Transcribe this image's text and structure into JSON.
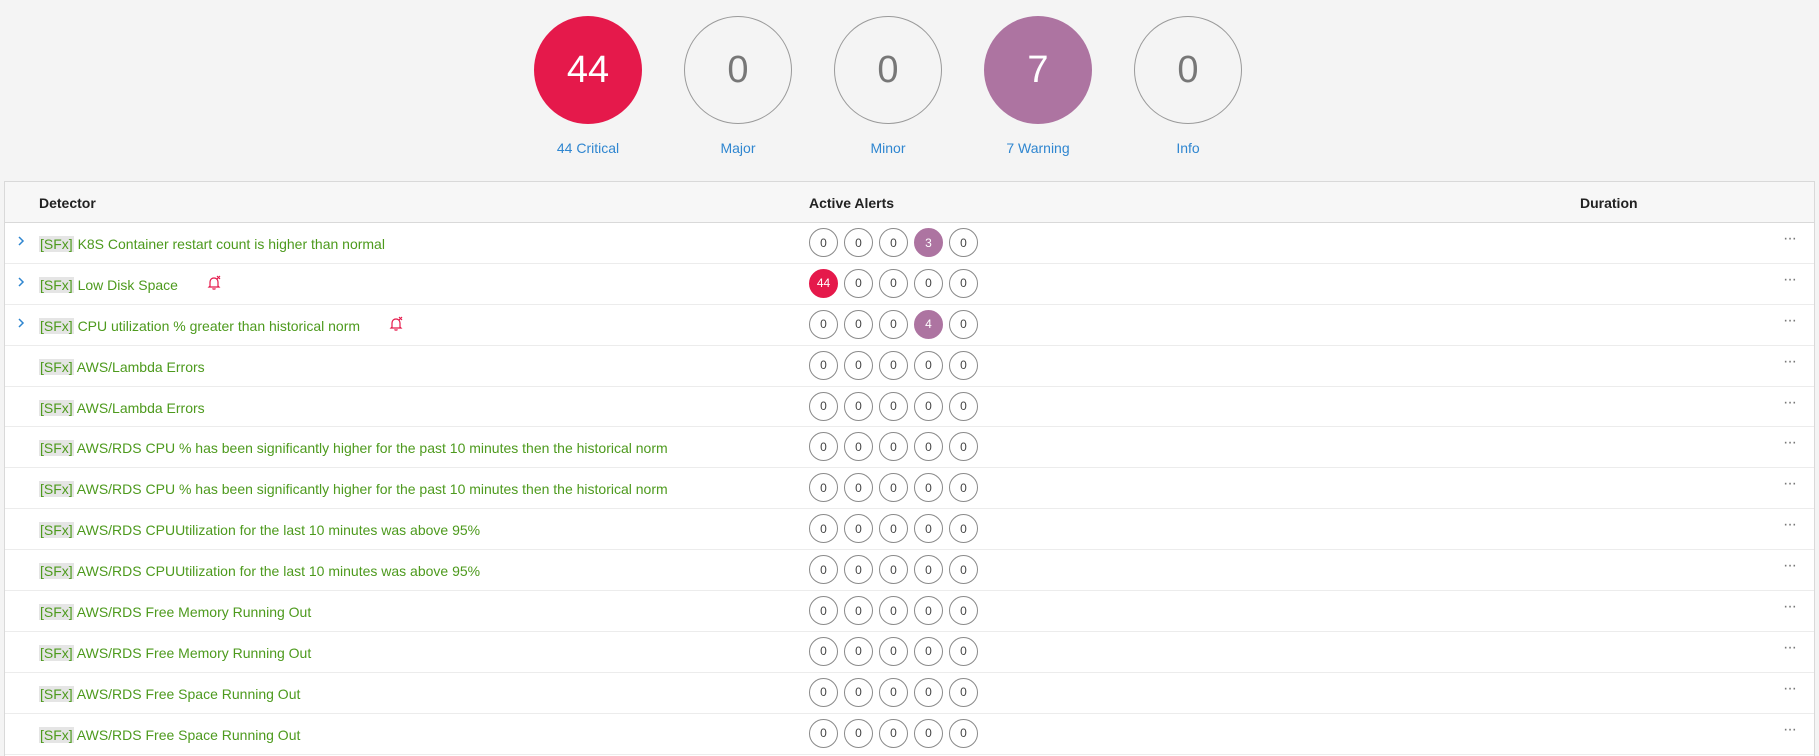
{
  "severity_summary": [
    {
      "key": "critical",
      "count": "44",
      "label": "44 Critical",
      "color": "#e5194b"
    },
    {
      "key": "major",
      "count": "0",
      "label": "Major",
      "color": ""
    },
    {
      "key": "minor",
      "count": "0",
      "label": "Minor",
      "color": ""
    },
    {
      "key": "warning",
      "count": "7",
      "label": "7 Warning",
      "color": "#ad74a1"
    },
    {
      "key": "info",
      "count": "0",
      "label": "Info",
      "color": ""
    }
  ],
  "table": {
    "headers": {
      "detector": "Detector",
      "active_alerts": "Active Alerts",
      "duration": "Duration"
    },
    "rows": [
      {
        "expandable": true,
        "tag": "[SFx]",
        "name": "K8S Container restart count is higher than normal",
        "muted": false,
        "alerts": [
          "0",
          "0",
          "0",
          "3",
          "0"
        ]
      },
      {
        "expandable": true,
        "tag": "[SFx]",
        "name": "Low Disk Space",
        "muted": true,
        "alerts": [
          "44",
          "0",
          "0",
          "0",
          "0"
        ]
      },
      {
        "expandable": true,
        "tag": "[SFx]",
        "name": "CPU utilization % greater than historical norm",
        "muted": true,
        "alerts": [
          "0",
          "0",
          "0",
          "4",
          "0"
        ]
      },
      {
        "expandable": false,
        "tag": "[SFx]",
        "name": "AWS/Lambda Errors",
        "muted": false,
        "alerts": [
          "0",
          "0",
          "0",
          "0",
          "0"
        ]
      },
      {
        "expandable": false,
        "tag": "[SFx]",
        "name": "AWS/Lambda Errors",
        "muted": false,
        "alerts": [
          "0",
          "0",
          "0",
          "0",
          "0"
        ]
      },
      {
        "expandable": false,
        "tag": "[SFx]",
        "name": "AWS/RDS CPU % has been significantly higher for the past 10 minutes then the historical norm",
        "muted": false,
        "alerts": [
          "0",
          "0",
          "0",
          "0",
          "0"
        ]
      },
      {
        "expandable": false,
        "tag": "[SFx]",
        "name": "AWS/RDS CPU % has been significantly higher for the past 10 minutes then the historical norm",
        "muted": false,
        "alerts": [
          "0",
          "0",
          "0",
          "0",
          "0"
        ]
      },
      {
        "expandable": false,
        "tag": "[SFx]",
        "name": "AWS/RDS CPUUtilization for the last 10 minutes was above 95%",
        "muted": false,
        "alerts": [
          "0",
          "0",
          "0",
          "0",
          "0"
        ]
      },
      {
        "expandable": false,
        "tag": "[SFx]",
        "name": "AWS/RDS CPUUtilization for the last 10 minutes was above 95%",
        "muted": false,
        "alerts": [
          "0",
          "0",
          "0",
          "0",
          "0"
        ]
      },
      {
        "expandable": false,
        "tag": "[SFx]",
        "name": "AWS/RDS Free Memory Running Out",
        "muted": false,
        "alerts": [
          "0",
          "0",
          "0",
          "0",
          "0"
        ]
      },
      {
        "expandable": false,
        "tag": "[SFx]",
        "name": "AWS/RDS Free Memory Running Out",
        "muted": false,
        "alerts": [
          "0",
          "0",
          "0",
          "0",
          "0"
        ]
      },
      {
        "expandable": false,
        "tag": "[SFx]",
        "name": "AWS/RDS Free Space Running Out",
        "muted": false,
        "alerts": [
          "0",
          "0",
          "0",
          "0",
          "0"
        ]
      },
      {
        "expandable": false,
        "tag": "[SFx]",
        "name": "AWS/RDS Free Space Running Out",
        "muted": false,
        "alerts": [
          "0",
          "0",
          "0",
          "0",
          "0"
        ]
      }
    ]
  },
  "icons": {
    "expand": "chevron-right-icon",
    "muted": "bell-muted-icon",
    "actions": "more-horizontal-icon"
  }
}
